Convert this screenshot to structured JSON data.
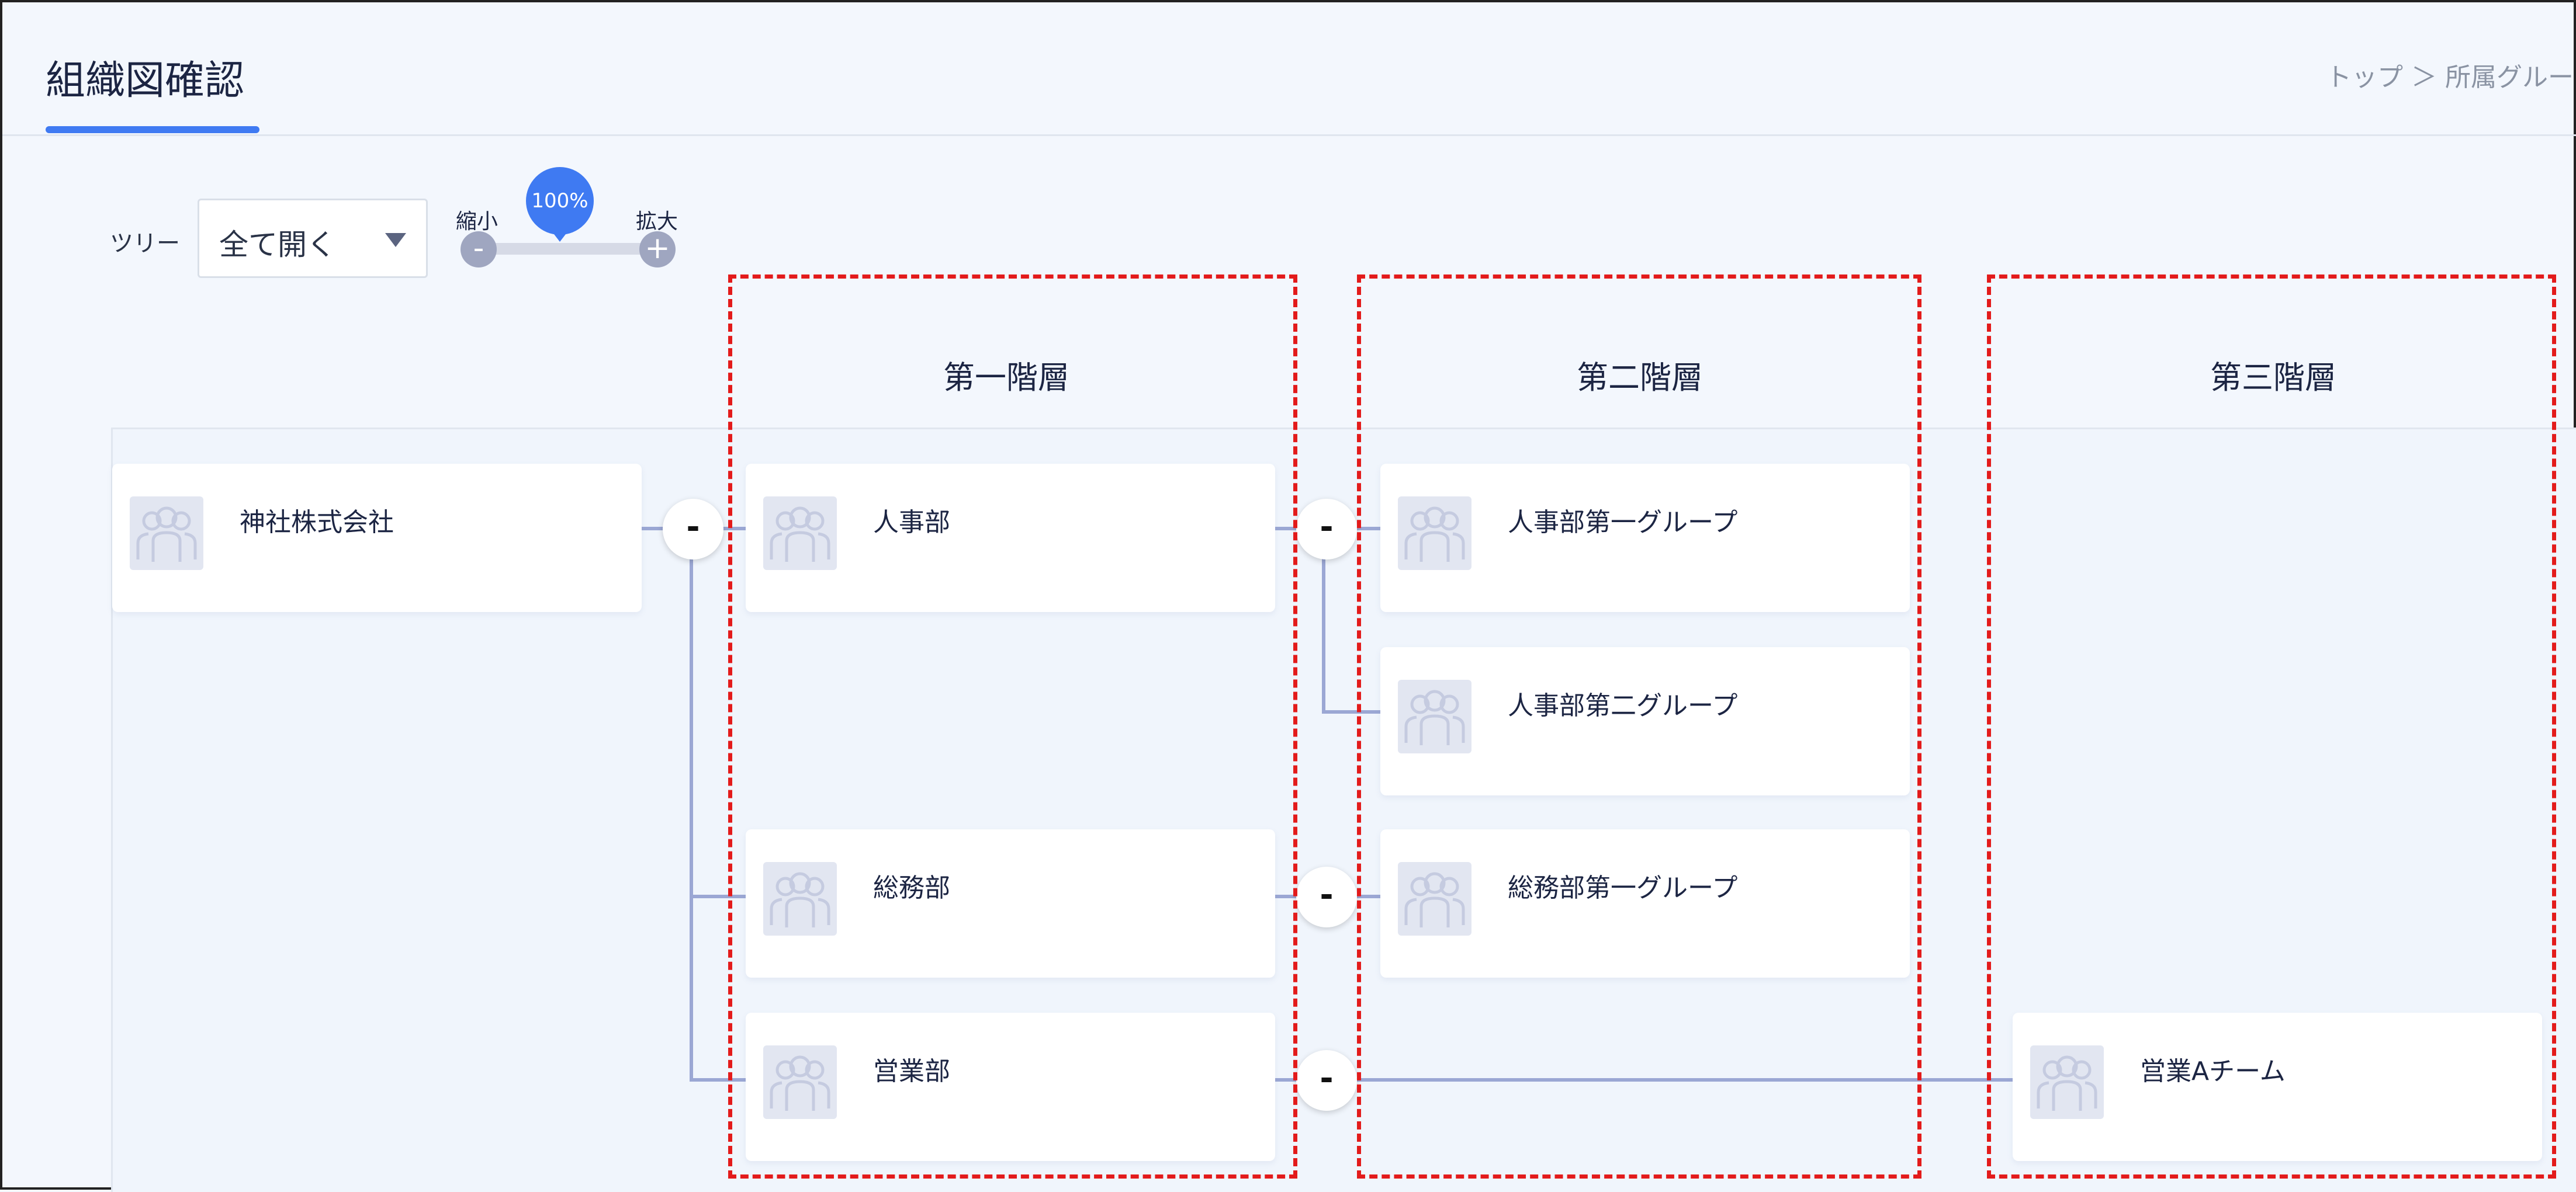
{
  "header": {
    "title": "組織図確認",
    "breadcrumb": "トップ ＞ 所属グルー"
  },
  "toolbar": {
    "tree_label": "ツリー",
    "tree_select_value": "全て開く",
    "zoom_out_label": "縮小",
    "zoom_in_label": "拡大",
    "zoom_value": "100%",
    "zoom_minus": "-",
    "zoom_plus": "+"
  },
  "levels": [
    "第一階層",
    "第二階層",
    "第三階層"
  ],
  "nodes": {
    "root": "神社株式会社",
    "jinji": "人事部",
    "somu": "総務部",
    "eigyo": "営業部",
    "jinji_g1": "人事部第一グループ",
    "jinji_g2": "人事部第二グループ",
    "somu_g1": "総務部第一グループ",
    "eigyo_a": "営業Aチーム"
  },
  "toggles": {
    "symbol": "-"
  },
  "colors": {
    "accent": "#3f7af2",
    "highlight_dashed": "#e31b1b",
    "connector": "#9ba7d4"
  }
}
